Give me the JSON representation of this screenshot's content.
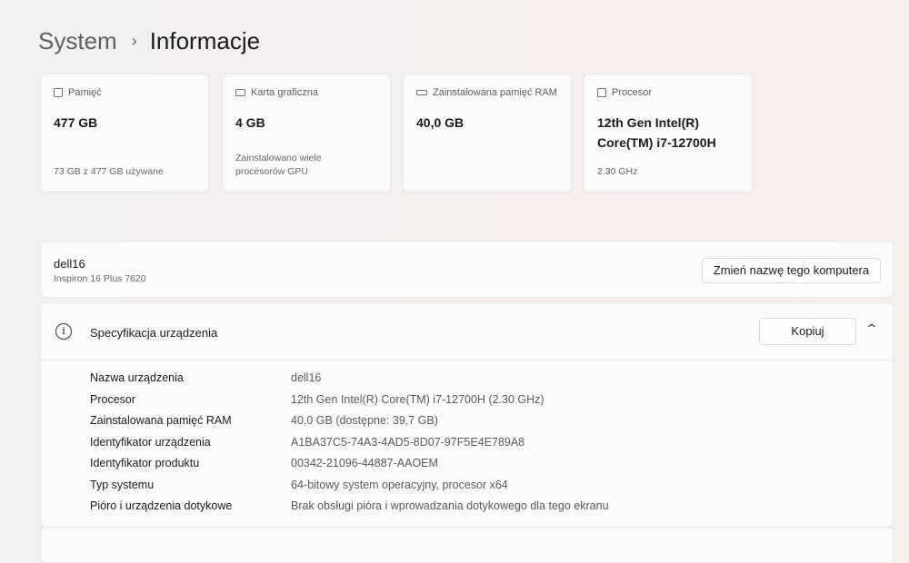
{
  "breadcrumb": {
    "parent": "System",
    "current": "Informacje"
  },
  "cards": [
    {
      "icon": "storage-icon",
      "label": "Pamięć",
      "value": "477 GB",
      "sub": "73 GB z 477 GB używane"
    },
    {
      "icon": "gpu-icon",
      "label": "Karta graficzna",
      "value": "4 GB",
      "sub": "Zainstalowano wiele procesorów GPU"
    },
    {
      "icon": "ram-icon",
      "label": "Zainstalowana pamięć RAM",
      "value": "40,0 GB",
      "sub": ""
    },
    {
      "icon": "cpu-icon",
      "label": "Procesor",
      "value": "12th Gen Intel(R) Core(TM) i7-12700H",
      "sub": "2.30 GHz"
    }
  ],
  "computer": {
    "name": "dell16",
    "model": "Inspiron 16 Plus 7620",
    "rename_label": "Zmień nazwę tego komputera"
  },
  "specs": {
    "title": "Specyfikacja urządzenia",
    "copy_label": "Kopiuj",
    "rows": [
      {
        "label": "Nazwa urządzenia",
        "value": "dell16"
      },
      {
        "label": "Procesor",
        "value": "12th Gen Intel(R) Core(TM) i7-12700H (2.30 GHz)"
      },
      {
        "label": "Zainstalowana pamięć RAM",
        "value": "40,0 GB (dostępne: 39,7 GB)"
      },
      {
        "label": "Identyfikator urządzenia",
        "value": "A1BA37C5-74A3-4AD5-8D07-97F5E4E789A8"
      },
      {
        "label": "Identyfikator produktu",
        "value": "00342-21096-44887-AAOEM"
      },
      {
        "label": "Typ systemu",
        "value": "64-bitowy system operacyjny, procesor x64"
      },
      {
        "label": "Pióro i urządzenia dotykowe",
        "value": "Brak obsługi pióra i wprowadzania dotykowego dla tego ekranu"
      }
    ]
  }
}
